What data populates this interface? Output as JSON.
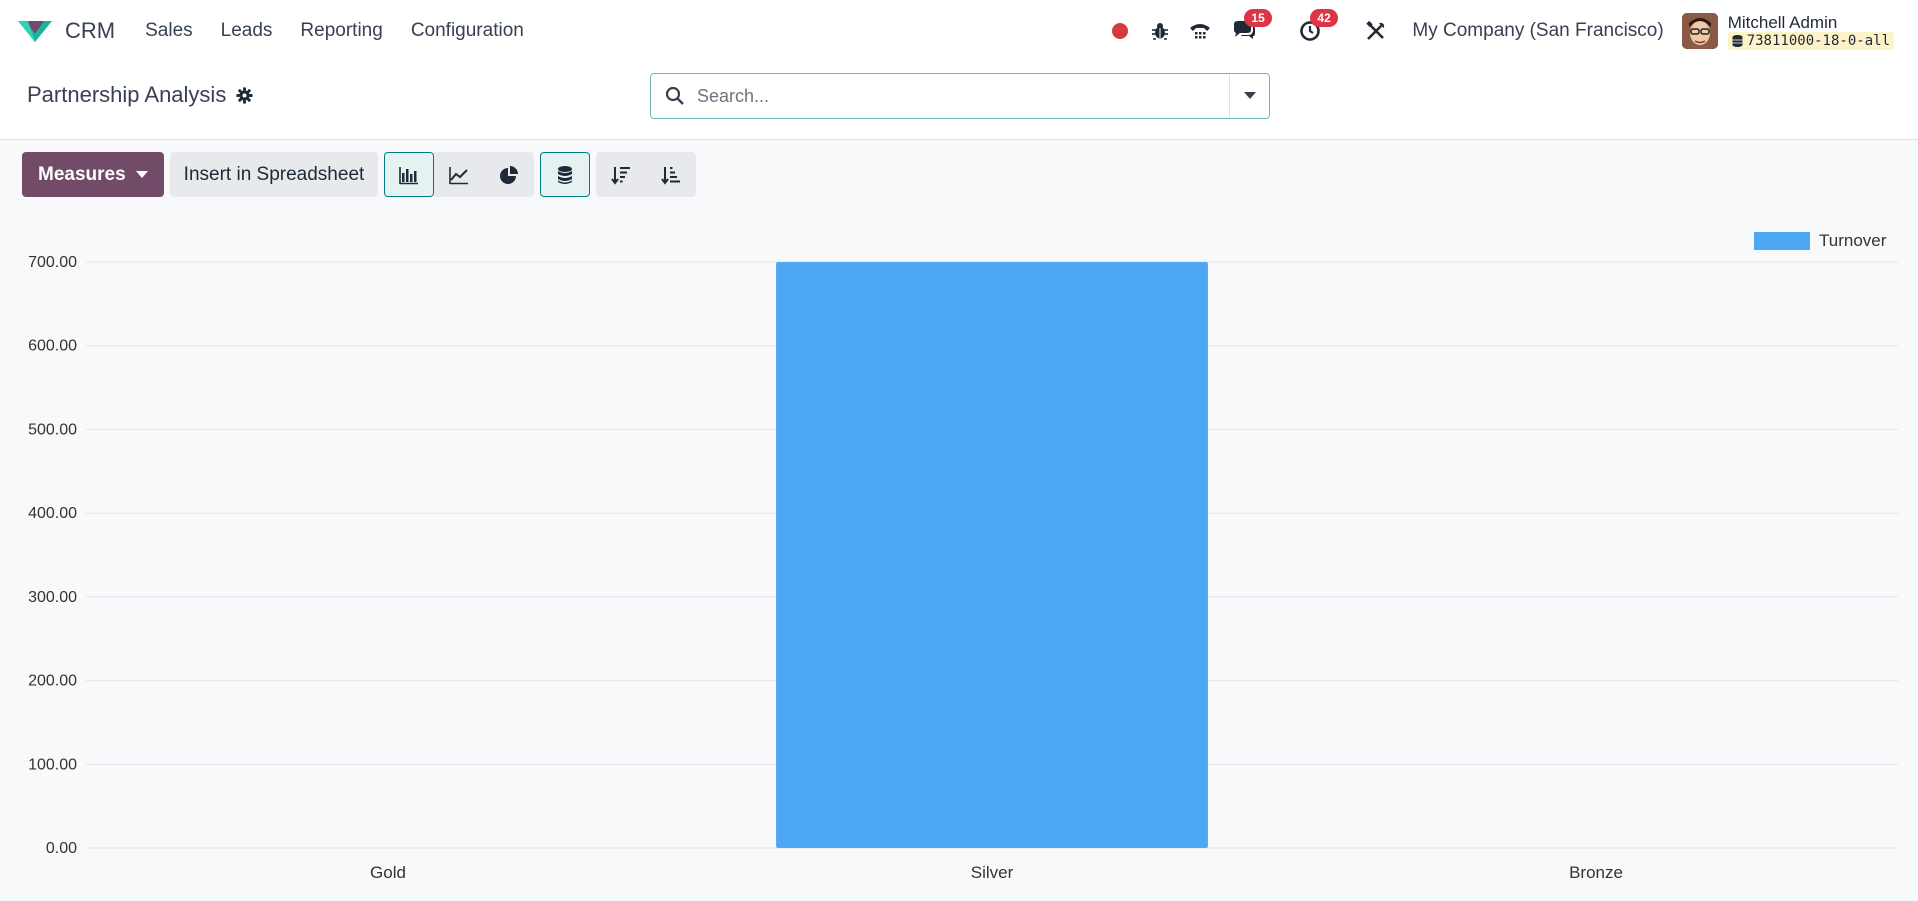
{
  "navbar": {
    "app_name": "CRM",
    "menu": [
      "Sales",
      "Leads",
      "Reporting",
      "Configuration"
    ],
    "messages_count": "15",
    "activities_count": "42",
    "company": "My Company (San Francisco)",
    "user_name": "Mitchell Admin",
    "database": "73811000-18-0-all"
  },
  "control": {
    "title": "Partnership Analysis",
    "search_placeholder": "Search..."
  },
  "toolbar": {
    "measures_label": "Measures",
    "insert_label": "Insert in Spreadsheet"
  },
  "colors": {
    "brand": "#714b67",
    "bar": "#4ea7f2",
    "active_outline": "#017e84"
  },
  "chart_data": {
    "type": "bar",
    "categories": [
      "Gold",
      "Silver",
      "Bronze"
    ],
    "series": [
      {
        "name": "Turnover",
        "values": [
          0,
          700,
          0
        ]
      }
    ],
    "ylim": [
      0,
      700
    ],
    "yticks": [
      0,
      100,
      200,
      300,
      400,
      500,
      600,
      700
    ],
    "ytick_labels": [
      "0.00",
      "100.00",
      "200.00",
      "300.00",
      "400.00",
      "500.00",
      "600.00",
      "700.00"
    ],
    "grid": true,
    "legend": "top-right"
  }
}
